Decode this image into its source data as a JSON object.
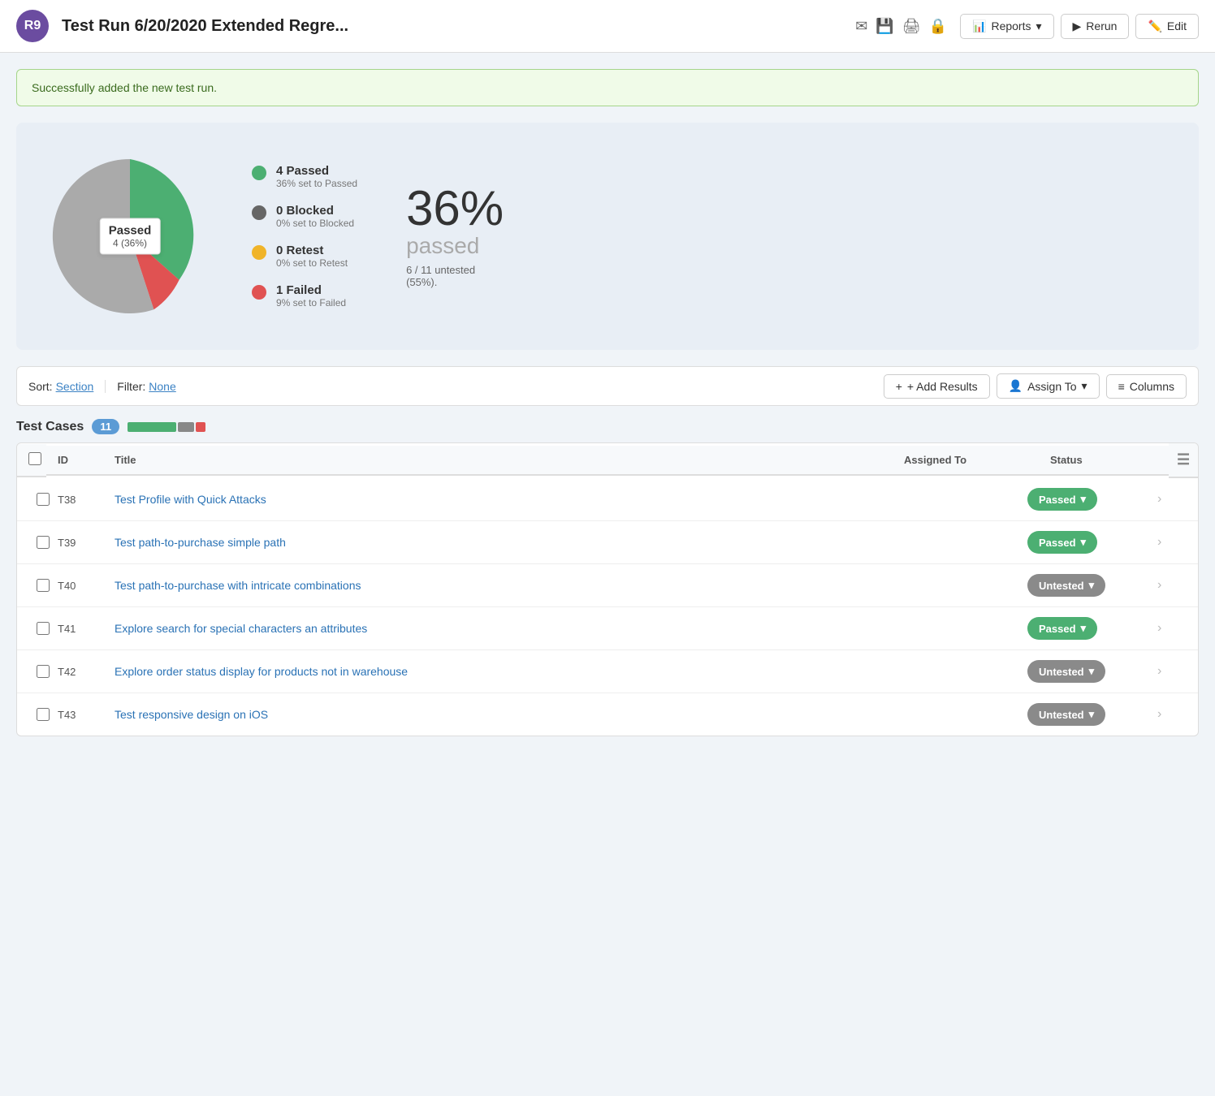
{
  "header": {
    "avatar_initials": "R9",
    "avatar_bg": "#6b4ca0",
    "title": "Test Run 6/20/2020 Extended Regre...",
    "buttons": [
      {
        "label": "Reports",
        "icon": "📊",
        "has_dropdown": true
      },
      {
        "label": "Rerun",
        "icon": "▶",
        "has_dropdown": false
      },
      {
        "label": "Edit",
        "icon": "✏️",
        "has_dropdown": false
      }
    ]
  },
  "success_banner": "Successfully added the new test run.",
  "chart": {
    "segments": [
      {
        "label": "passed",
        "color": "#4caf72",
        "percent": 36
      },
      {
        "label": "failed",
        "color": "#e05252",
        "percent": 9
      },
      {
        "label": "untested",
        "color": "#aaaaaa",
        "percent": 55
      }
    ],
    "center_label": "Passed",
    "center_sub": "4 (36%)"
  },
  "legend": [
    {
      "color": "#4caf72",
      "title": "4 Passed",
      "sub": "36% set to Passed"
    },
    {
      "color": "#666666",
      "title": "0 Blocked",
      "sub": "0% set to Blocked"
    },
    {
      "color": "#f0b429",
      "title": "0 Retest",
      "sub": "0% set to Retest"
    },
    {
      "color": "#e05252",
      "title": "1 Failed",
      "sub": "9% set to Failed"
    }
  ],
  "big_stat": {
    "percent": "36%",
    "label": "passed",
    "sub": "6 / 11 untested\n(55%)."
  },
  "toolbar": {
    "sort_label": "Sort:",
    "sort_value": "Section",
    "filter_label": "Filter:",
    "filter_value": "None",
    "add_results_label": "+ Add Results",
    "assign_to_label": "Assign To",
    "columns_label": "Columns"
  },
  "test_cases": {
    "title": "Test Cases",
    "count": "11",
    "progress_segments": [
      {
        "color": "#4caf72",
        "width": 60
      },
      {
        "color": "#888888",
        "width": 20
      },
      {
        "color": "#e05252",
        "width": 10
      }
    ],
    "columns": [
      "",
      "ID",
      "Title",
      "Assigned To",
      "Status",
      ""
    ],
    "rows": [
      {
        "id": "T38",
        "title": "Test Profile with Quick Attacks",
        "assigned": "",
        "status": "Passed",
        "status_type": "passed"
      },
      {
        "id": "T39",
        "title": "Test path-to-purchase simple path",
        "assigned": "",
        "status": "Passed",
        "status_type": "passed"
      },
      {
        "id": "T40",
        "title": "Test path-to-purchase with intricate combinations",
        "assigned": "",
        "status": "Untested",
        "status_type": "untested"
      },
      {
        "id": "T41",
        "title": "Explore search for special characters an attributes",
        "assigned": "",
        "status": "Passed",
        "status_type": "passed"
      },
      {
        "id": "T42",
        "title": "Explore order status display for products not in warehouse",
        "assigned": "",
        "status": "Untested",
        "status_type": "untested"
      },
      {
        "id": "T43",
        "title": "Test responsive design on iOS",
        "assigned": "",
        "status": "Untested",
        "status_type": "untested"
      }
    ]
  }
}
